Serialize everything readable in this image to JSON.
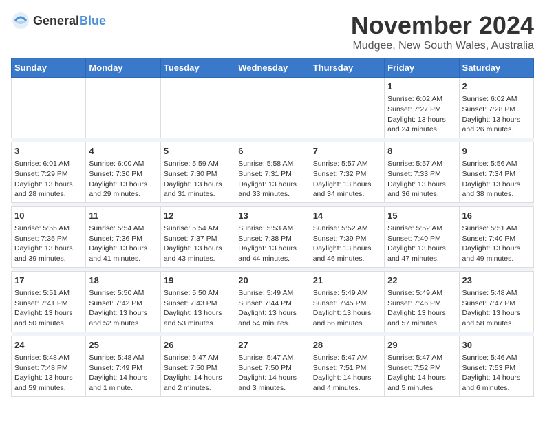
{
  "logo": {
    "general": "General",
    "blue": "Blue"
  },
  "title": "November 2024",
  "subtitle": "Mudgee, New South Wales, Australia",
  "days_of_week": [
    "Sunday",
    "Monday",
    "Tuesday",
    "Wednesday",
    "Thursday",
    "Friday",
    "Saturday"
  ],
  "weeks": [
    [
      {
        "day": "",
        "info": ""
      },
      {
        "day": "",
        "info": ""
      },
      {
        "day": "",
        "info": ""
      },
      {
        "day": "",
        "info": ""
      },
      {
        "day": "",
        "info": ""
      },
      {
        "day": "1",
        "info": "Sunrise: 6:02 AM\nSunset: 7:27 PM\nDaylight: 13 hours\nand 24 minutes."
      },
      {
        "day": "2",
        "info": "Sunrise: 6:02 AM\nSunset: 7:28 PM\nDaylight: 13 hours\nand 26 minutes."
      }
    ],
    [
      {
        "day": "3",
        "info": "Sunrise: 6:01 AM\nSunset: 7:29 PM\nDaylight: 13 hours\nand 28 minutes."
      },
      {
        "day": "4",
        "info": "Sunrise: 6:00 AM\nSunset: 7:30 PM\nDaylight: 13 hours\nand 29 minutes."
      },
      {
        "day": "5",
        "info": "Sunrise: 5:59 AM\nSunset: 7:30 PM\nDaylight: 13 hours\nand 31 minutes."
      },
      {
        "day": "6",
        "info": "Sunrise: 5:58 AM\nSunset: 7:31 PM\nDaylight: 13 hours\nand 33 minutes."
      },
      {
        "day": "7",
        "info": "Sunrise: 5:57 AM\nSunset: 7:32 PM\nDaylight: 13 hours\nand 34 minutes."
      },
      {
        "day": "8",
        "info": "Sunrise: 5:57 AM\nSunset: 7:33 PM\nDaylight: 13 hours\nand 36 minutes."
      },
      {
        "day": "9",
        "info": "Sunrise: 5:56 AM\nSunset: 7:34 PM\nDaylight: 13 hours\nand 38 minutes."
      }
    ],
    [
      {
        "day": "10",
        "info": "Sunrise: 5:55 AM\nSunset: 7:35 PM\nDaylight: 13 hours\nand 39 minutes."
      },
      {
        "day": "11",
        "info": "Sunrise: 5:54 AM\nSunset: 7:36 PM\nDaylight: 13 hours\nand 41 minutes."
      },
      {
        "day": "12",
        "info": "Sunrise: 5:54 AM\nSunset: 7:37 PM\nDaylight: 13 hours\nand 43 minutes."
      },
      {
        "day": "13",
        "info": "Sunrise: 5:53 AM\nSunset: 7:38 PM\nDaylight: 13 hours\nand 44 minutes."
      },
      {
        "day": "14",
        "info": "Sunrise: 5:52 AM\nSunset: 7:39 PM\nDaylight: 13 hours\nand 46 minutes."
      },
      {
        "day": "15",
        "info": "Sunrise: 5:52 AM\nSunset: 7:40 PM\nDaylight: 13 hours\nand 47 minutes."
      },
      {
        "day": "16",
        "info": "Sunrise: 5:51 AM\nSunset: 7:40 PM\nDaylight: 13 hours\nand 49 minutes."
      }
    ],
    [
      {
        "day": "17",
        "info": "Sunrise: 5:51 AM\nSunset: 7:41 PM\nDaylight: 13 hours\nand 50 minutes."
      },
      {
        "day": "18",
        "info": "Sunrise: 5:50 AM\nSunset: 7:42 PM\nDaylight: 13 hours\nand 52 minutes."
      },
      {
        "day": "19",
        "info": "Sunrise: 5:50 AM\nSunset: 7:43 PM\nDaylight: 13 hours\nand 53 minutes."
      },
      {
        "day": "20",
        "info": "Sunrise: 5:49 AM\nSunset: 7:44 PM\nDaylight: 13 hours\nand 54 minutes."
      },
      {
        "day": "21",
        "info": "Sunrise: 5:49 AM\nSunset: 7:45 PM\nDaylight: 13 hours\nand 56 minutes."
      },
      {
        "day": "22",
        "info": "Sunrise: 5:49 AM\nSunset: 7:46 PM\nDaylight: 13 hours\nand 57 minutes."
      },
      {
        "day": "23",
        "info": "Sunrise: 5:48 AM\nSunset: 7:47 PM\nDaylight: 13 hours\nand 58 minutes."
      }
    ],
    [
      {
        "day": "24",
        "info": "Sunrise: 5:48 AM\nSunset: 7:48 PM\nDaylight: 13 hours\nand 59 minutes."
      },
      {
        "day": "25",
        "info": "Sunrise: 5:48 AM\nSunset: 7:49 PM\nDaylight: 14 hours\nand 1 minute."
      },
      {
        "day": "26",
        "info": "Sunrise: 5:47 AM\nSunset: 7:50 PM\nDaylight: 14 hours\nand 2 minutes."
      },
      {
        "day": "27",
        "info": "Sunrise: 5:47 AM\nSunset: 7:50 PM\nDaylight: 14 hours\nand 3 minutes."
      },
      {
        "day": "28",
        "info": "Sunrise: 5:47 AM\nSunset: 7:51 PM\nDaylight: 14 hours\nand 4 minutes."
      },
      {
        "day": "29",
        "info": "Sunrise: 5:47 AM\nSunset: 7:52 PM\nDaylight: 14 hours\nand 5 minutes."
      },
      {
        "day": "30",
        "info": "Sunrise: 5:46 AM\nSunset: 7:53 PM\nDaylight: 14 hours\nand 6 minutes."
      }
    ]
  ]
}
